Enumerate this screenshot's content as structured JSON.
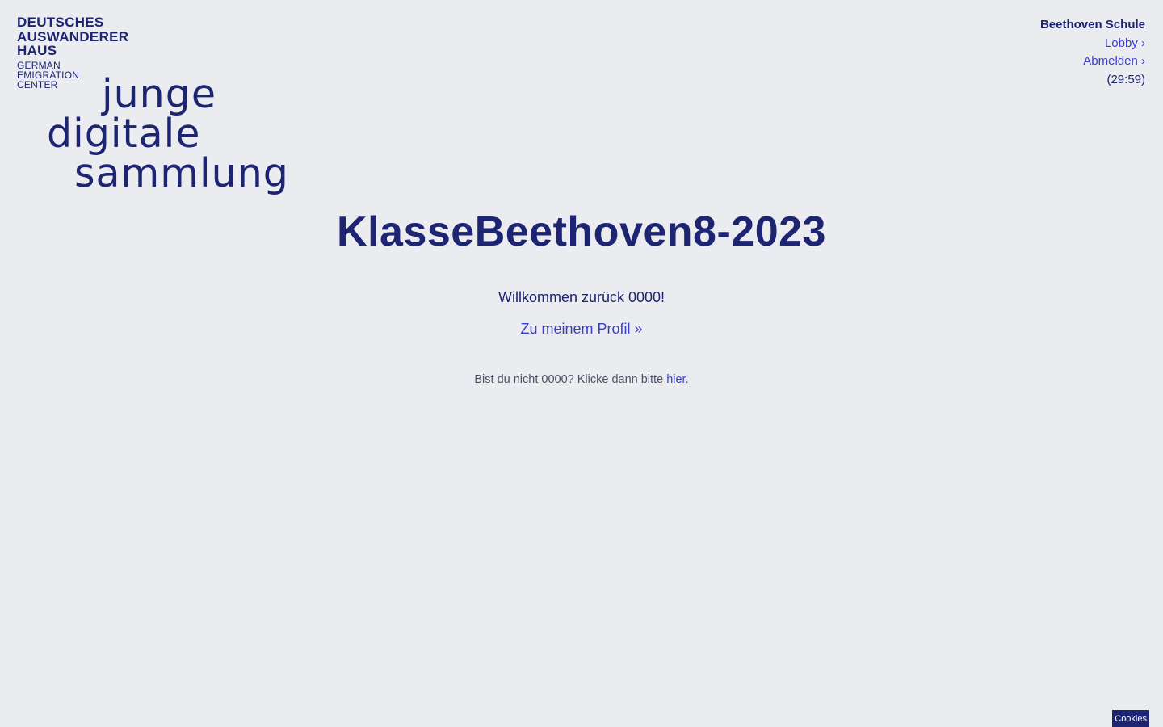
{
  "brand": {
    "museum_line1": "DEUTSCHES",
    "museum_line2": "AUSWANDERER",
    "museum_line3": "HAUS",
    "sub_line1": "GERMAN",
    "sub_line2": "EMIGRATION",
    "sub_line3": "CENTER",
    "logo_line1": "junge",
    "logo_line2": "digitale",
    "logo_line3": "sammlung"
  },
  "topnav": {
    "school": "Beethoven Schule",
    "lobby": "Lobby ›",
    "logout": "Abmelden ›",
    "timer": "(29:59)"
  },
  "main": {
    "title": "KlasseBeethoven8-2023",
    "welcome": "Willkommen zurück 0000!",
    "profile_link": "Zu meinem Profil »",
    "notme_prefix": "Bist du nicht 0000? Klicke dann bitte ",
    "notme_link": "hier",
    "notme_suffix": "."
  },
  "cookies": {
    "label": "Cookies"
  },
  "colors": {
    "background": "#ebecef",
    "primary": "#1d2471",
    "link": "#3a3fc9"
  }
}
